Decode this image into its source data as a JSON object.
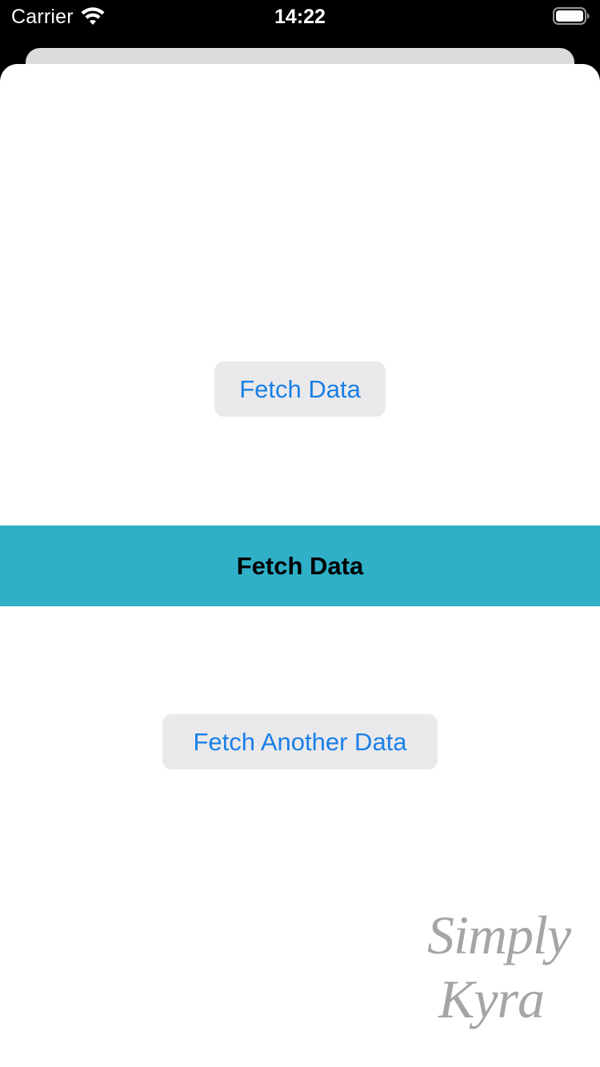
{
  "status_bar": {
    "carrier": "Carrier",
    "time": "14:22",
    "wifi_icon": "wifi-icon",
    "battery_icon": "battery-icon"
  },
  "main": {
    "fetch_button_label": "Fetch Data",
    "banner_text": "Fetch Data",
    "fetch_another_button_label": "Fetch Another Data"
  },
  "watermark": {
    "line1": "Simply",
    "line2": "Kyra"
  },
  "colors": {
    "accent": "#1a7fe6",
    "banner": "#2fb0c7",
    "button_bg": "#e9e9eb"
  }
}
